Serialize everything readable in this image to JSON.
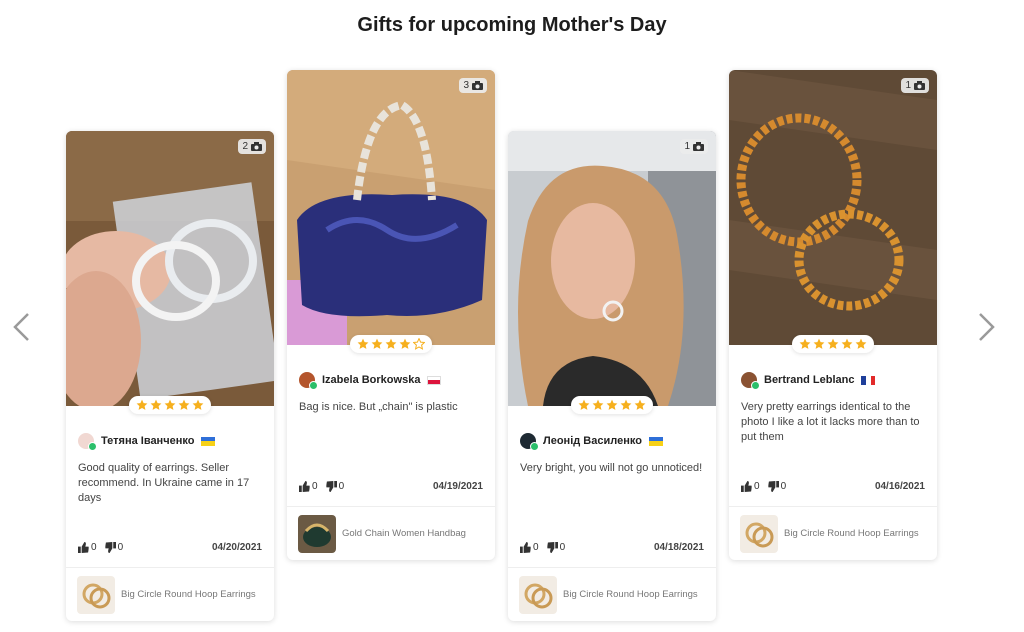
{
  "page": {
    "title": "Gifts for upcoming Mother's Day"
  },
  "icons": {
    "prev": "chevron-left-icon",
    "next": "chevron-right-icon",
    "camera": "camera-icon",
    "like": "thumbs-up-icon",
    "dislike": "thumbs-down-icon",
    "star": "star-icon"
  },
  "colors": {
    "star": "#f6b01e",
    "verified": "#2bbf6a",
    "date": "#444444"
  },
  "cards": [
    {
      "photo_count": "2",
      "rating": 5,
      "author": "Тетяна Іванченко",
      "country": "Ukraine",
      "text": "Good quality of earrings. Seller recommend. In Ukraine came in 17 days",
      "likes": "0",
      "dislikes": "0",
      "date": "04/20/2021",
      "product": "Big Circle Round Hoop Earrings"
    },
    {
      "photo_count": "3",
      "rating": 4,
      "author": "Izabela Borkowska",
      "country": "Poland",
      "text": "Bag is nice. But „chain\" is plastic",
      "likes": "0",
      "dislikes": "0",
      "date": "04/19/2021",
      "product": "Gold Chain Women Handbag"
    },
    {
      "photo_count": "1",
      "rating": 5,
      "author": "Леонід Василенко",
      "country": "Ukraine",
      "text": "Very bright, you will not go unnoticed!",
      "likes": "0",
      "dislikes": "0",
      "date": "04/18/2021",
      "product": "Big Circle Round Hoop Earrings"
    },
    {
      "photo_count": "1",
      "rating": 5,
      "author": "Bertrand Leblanc",
      "country": "France",
      "text": "Very pretty earrings identical to the photo I like a lot it lacks more than to put them",
      "likes": "0",
      "dislikes": "0",
      "date": "04/16/2021",
      "product": "Big Circle Round Hoop Earrings"
    }
  ]
}
